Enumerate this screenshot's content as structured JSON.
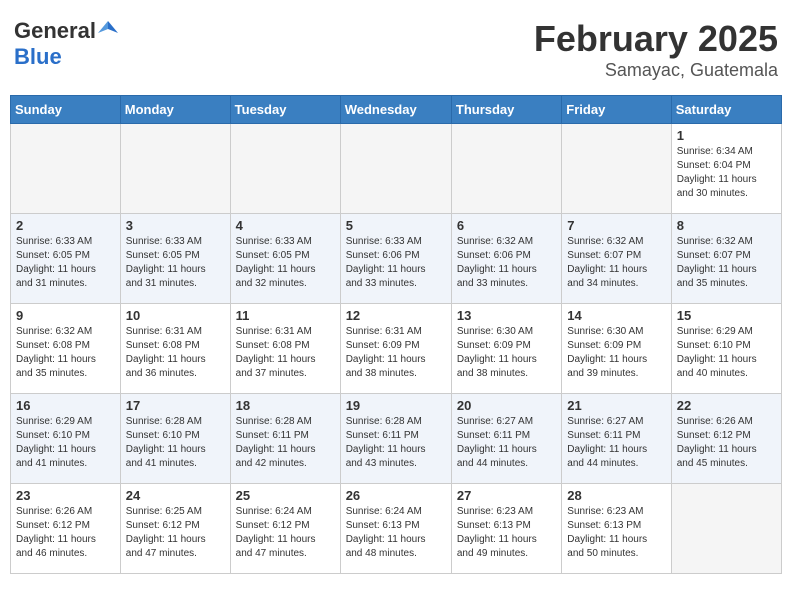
{
  "header": {
    "logo_general": "General",
    "logo_blue": "Blue",
    "title": "February 2025",
    "location": "Samayac, Guatemala"
  },
  "weekdays": [
    "Sunday",
    "Monday",
    "Tuesday",
    "Wednesday",
    "Thursday",
    "Friday",
    "Saturday"
  ],
  "weeks": [
    {
      "alt": false,
      "days": [
        {
          "num": "",
          "info": ""
        },
        {
          "num": "",
          "info": ""
        },
        {
          "num": "",
          "info": ""
        },
        {
          "num": "",
          "info": ""
        },
        {
          "num": "",
          "info": ""
        },
        {
          "num": "",
          "info": ""
        },
        {
          "num": "1",
          "info": "Sunrise: 6:34 AM\nSunset: 6:04 PM\nDaylight: 11 hours\nand 30 minutes."
        }
      ]
    },
    {
      "alt": true,
      "days": [
        {
          "num": "2",
          "info": "Sunrise: 6:33 AM\nSunset: 6:05 PM\nDaylight: 11 hours\nand 31 minutes."
        },
        {
          "num": "3",
          "info": "Sunrise: 6:33 AM\nSunset: 6:05 PM\nDaylight: 11 hours\nand 31 minutes."
        },
        {
          "num": "4",
          "info": "Sunrise: 6:33 AM\nSunset: 6:05 PM\nDaylight: 11 hours\nand 32 minutes."
        },
        {
          "num": "5",
          "info": "Sunrise: 6:33 AM\nSunset: 6:06 PM\nDaylight: 11 hours\nand 33 minutes."
        },
        {
          "num": "6",
          "info": "Sunrise: 6:32 AM\nSunset: 6:06 PM\nDaylight: 11 hours\nand 33 minutes."
        },
        {
          "num": "7",
          "info": "Sunrise: 6:32 AM\nSunset: 6:07 PM\nDaylight: 11 hours\nand 34 minutes."
        },
        {
          "num": "8",
          "info": "Sunrise: 6:32 AM\nSunset: 6:07 PM\nDaylight: 11 hours\nand 35 minutes."
        }
      ]
    },
    {
      "alt": false,
      "days": [
        {
          "num": "9",
          "info": "Sunrise: 6:32 AM\nSunset: 6:08 PM\nDaylight: 11 hours\nand 35 minutes."
        },
        {
          "num": "10",
          "info": "Sunrise: 6:31 AM\nSunset: 6:08 PM\nDaylight: 11 hours\nand 36 minutes."
        },
        {
          "num": "11",
          "info": "Sunrise: 6:31 AM\nSunset: 6:08 PM\nDaylight: 11 hours\nand 37 minutes."
        },
        {
          "num": "12",
          "info": "Sunrise: 6:31 AM\nSunset: 6:09 PM\nDaylight: 11 hours\nand 38 minutes."
        },
        {
          "num": "13",
          "info": "Sunrise: 6:30 AM\nSunset: 6:09 PM\nDaylight: 11 hours\nand 38 minutes."
        },
        {
          "num": "14",
          "info": "Sunrise: 6:30 AM\nSunset: 6:09 PM\nDaylight: 11 hours\nand 39 minutes."
        },
        {
          "num": "15",
          "info": "Sunrise: 6:29 AM\nSunset: 6:10 PM\nDaylight: 11 hours\nand 40 minutes."
        }
      ]
    },
    {
      "alt": true,
      "days": [
        {
          "num": "16",
          "info": "Sunrise: 6:29 AM\nSunset: 6:10 PM\nDaylight: 11 hours\nand 41 minutes."
        },
        {
          "num": "17",
          "info": "Sunrise: 6:28 AM\nSunset: 6:10 PM\nDaylight: 11 hours\nand 41 minutes."
        },
        {
          "num": "18",
          "info": "Sunrise: 6:28 AM\nSunset: 6:11 PM\nDaylight: 11 hours\nand 42 minutes."
        },
        {
          "num": "19",
          "info": "Sunrise: 6:28 AM\nSunset: 6:11 PM\nDaylight: 11 hours\nand 43 minutes."
        },
        {
          "num": "20",
          "info": "Sunrise: 6:27 AM\nSunset: 6:11 PM\nDaylight: 11 hours\nand 44 minutes."
        },
        {
          "num": "21",
          "info": "Sunrise: 6:27 AM\nSunset: 6:11 PM\nDaylight: 11 hours\nand 44 minutes."
        },
        {
          "num": "22",
          "info": "Sunrise: 6:26 AM\nSunset: 6:12 PM\nDaylight: 11 hours\nand 45 minutes."
        }
      ]
    },
    {
      "alt": false,
      "days": [
        {
          "num": "23",
          "info": "Sunrise: 6:26 AM\nSunset: 6:12 PM\nDaylight: 11 hours\nand 46 minutes."
        },
        {
          "num": "24",
          "info": "Sunrise: 6:25 AM\nSunset: 6:12 PM\nDaylight: 11 hours\nand 47 minutes."
        },
        {
          "num": "25",
          "info": "Sunrise: 6:24 AM\nSunset: 6:12 PM\nDaylight: 11 hours\nand 47 minutes."
        },
        {
          "num": "26",
          "info": "Sunrise: 6:24 AM\nSunset: 6:13 PM\nDaylight: 11 hours\nand 48 minutes."
        },
        {
          "num": "27",
          "info": "Sunrise: 6:23 AM\nSunset: 6:13 PM\nDaylight: 11 hours\nand 49 minutes."
        },
        {
          "num": "28",
          "info": "Sunrise: 6:23 AM\nSunset: 6:13 PM\nDaylight: 11 hours\nand 50 minutes."
        },
        {
          "num": "",
          "info": ""
        }
      ]
    }
  ]
}
